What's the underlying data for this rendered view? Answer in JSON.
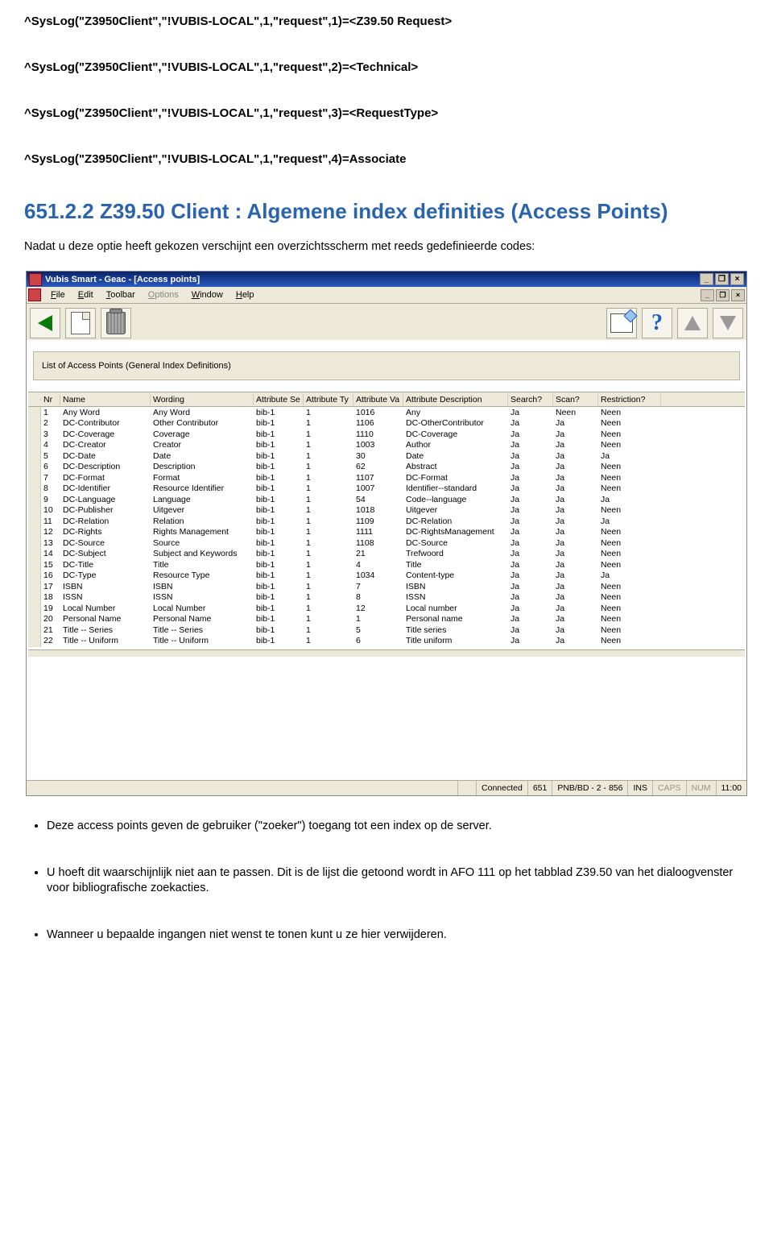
{
  "code_lines": [
    "^SysLog(\"Z3950Client\",\"!VUBIS-LOCAL\",1,\"request\",1)=<Z39.50 Request>",
    "^SysLog(\"Z3950Client\",\"!VUBIS-LOCAL\",1,\"request\",2)=<Technical>",
    "^SysLog(\"Z3950Client\",\"!VUBIS-LOCAL\",1,\"request\",3)=<RequestType>",
    "^SysLog(\"Z3950Client\",\"!VUBIS-LOCAL\",1,\"request\",4)=Associate"
  ],
  "heading": "651.2.2 Z39.50 Client : Algemene index definities (Access Points)",
  "intro": "Nadat u deze optie heeft gekozen verschijnt een overzichtsscherm met reeds gedefinieerde codes:",
  "app": {
    "title": "Vubis Smart - Geac - [Access points]",
    "menu": {
      "file": "File",
      "edit": "Edit",
      "toolbar": "Toolbar",
      "options": "Options",
      "window": "Window",
      "help": "Help"
    },
    "panel": "List of Access Points (General Index Definitions)",
    "columns": {
      "nr": "Nr",
      "name": "Name",
      "wording": "Wording",
      "attrset": "Attribute Se",
      "attrtype": "Attribute Ty",
      "attrval": "Attribute Va",
      "attrdesc": "Attribute Description",
      "search": "Search?",
      "scan": "Scan?",
      "restriction": "Restriction?"
    },
    "rows": [
      {
        "nr": "1",
        "name": "Any Word",
        "wording": "Any Word",
        "set": "bib-1",
        "type": "1",
        "val": "1016",
        "desc": "Any",
        "search": "Ja",
        "scan": "Neen",
        "restr": "Neen"
      },
      {
        "nr": "2",
        "name": "DC-Contributor",
        "wording": "Other Contributor",
        "set": "bib-1",
        "type": "1",
        "val": "1106",
        "desc": "DC-OtherContributor",
        "search": "Ja",
        "scan": "Ja",
        "restr": "Neen"
      },
      {
        "nr": "3",
        "name": "DC-Coverage",
        "wording": "Coverage",
        "set": "bib-1",
        "type": "1",
        "val": "1110",
        "desc": "DC-Coverage",
        "search": "Ja",
        "scan": "Ja",
        "restr": "Neen"
      },
      {
        "nr": "4",
        "name": "DC-Creator",
        "wording": "Creator",
        "set": "bib-1",
        "type": "1",
        "val": "1003",
        "desc": "Author",
        "search": "Ja",
        "scan": "Ja",
        "restr": "Neen"
      },
      {
        "nr": "5",
        "name": "DC-Date",
        "wording": "Date",
        "set": "bib-1",
        "type": "1",
        "val": "30",
        "desc": "Date",
        "search": "Ja",
        "scan": "Ja",
        "restr": "Ja"
      },
      {
        "nr": "6",
        "name": "DC-Description",
        "wording": "Description",
        "set": "bib-1",
        "type": "1",
        "val": "62",
        "desc": "Abstract",
        "search": "Ja",
        "scan": "Ja",
        "restr": "Neen"
      },
      {
        "nr": "7",
        "name": "DC-Format",
        "wording": "Format",
        "set": "bib-1",
        "type": "1",
        "val": "1107",
        "desc": "DC-Format",
        "search": "Ja",
        "scan": "Ja",
        "restr": "Neen"
      },
      {
        "nr": "8",
        "name": "DC-Identifier",
        "wording": "Resource Identifier",
        "set": "bib-1",
        "type": "1",
        "val": "1007",
        "desc": "Identifier--standard",
        "search": "Ja",
        "scan": "Ja",
        "restr": "Neen"
      },
      {
        "nr": "9",
        "name": "DC-Language",
        "wording": "Language",
        "set": "bib-1",
        "type": "1",
        "val": "54",
        "desc": "Code--language",
        "search": "Ja",
        "scan": "Ja",
        "restr": "Ja"
      },
      {
        "nr": "10",
        "name": "DC-Publisher",
        "wording": "Uitgever",
        "set": "bib-1",
        "type": "1",
        "val": "1018",
        "desc": "Uitgever",
        "search": "Ja",
        "scan": "Ja",
        "restr": "Neen"
      },
      {
        "nr": "11",
        "name": "DC-Relation",
        "wording": "Relation",
        "set": "bib-1",
        "type": "1",
        "val": "1109",
        "desc": "DC-Relation",
        "search": "Ja",
        "scan": "Ja",
        "restr": "Ja"
      },
      {
        "nr": "12",
        "name": "DC-Rights",
        "wording": "Rights Management",
        "set": "bib-1",
        "type": "1",
        "val": "1111",
        "desc": "DC-RightsManagement",
        "search": "Ja",
        "scan": "Ja",
        "restr": "Neen"
      },
      {
        "nr": "13",
        "name": "DC-Source",
        "wording": "Source",
        "set": "bib-1",
        "type": "1",
        "val": "1108",
        "desc": "DC-Source",
        "search": "Ja",
        "scan": "Ja",
        "restr": "Neen"
      },
      {
        "nr": "14",
        "name": "DC-Subject",
        "wording": "Subject and Keywords",
        "set": "bib-1",
        "type": "1",
        "val": "21",
        "desc": "Trefwoord",
        "search": "Ja",
        "scan": "Ja",
        "restr": "Neen"
      },
      {
        "nr": "15",
        "name": "DC-Title",
        "wording": "Title",
        "set": "bib-1",
        "type": "1",
        "val": "4",
        "desc": "Title",
        "search": "Ja",
        "scan": "Ja",
        "restr": "Neen"
      },
      {
        "nr": "16",
        "name": "DC-Type",
        "wording": "Resource Type",
        "set": "bib-1",
        "type": "1",
        "val": "1034",
        "desc": "Content-type",
        "search": "Ja",
        "scan": "Ja",
        "restr": "Ja"
      },
      {
        "nr": "17",
        "name": "ISBN",
        "wording": "ISBN",
        "set": "bib-1",
        "type": "1",
        "val": "7",
        "desc": "ISBN",
        "search": "Ja",
        "scan": "Ja",
        "restr": "Neen"
      },
      {
        "nr": "18",
        "name": "ISSN",
        "wording": "ISSN",
        "set": "bib-1",
        "type": "1",
        "val": "8",
        "desc": "ISSN",
        "search": "Ja",
        "scan": "Ja",
        "restr": "Neen"
      },
      {
        "nr": "19",
        "name": "Local Number",
        "wording": "Local Number",
        "set": "bib-1",
        "type": "1",
        "val": "12",
        "desc": "Local number",
        "search": "Ja",
        "scan": "Ja",
        "restr": "Neen"
      },
      {
        "nr": "20",
        "name": "Personal Name",
        "wording": "Personal Name",
        "set": "bib-1",
        "type": "1",
        "val": "1",
        "desc": "Personal name",
        "search": "Ja",
        "scan": "Ja",
        "restr": "Neen"
      },
      {
        "nr": "21",
        "name": "Title -- Series",
        "wording": "Title -- Series",
        "set": "bib-1",
        "type": "1",
        "val": "5",
        "desc": "Title series",
        "search": "Ja",
        "scan": "Ja",
        "restr": "Neen"
      },
      {
        "nr": "22",
        "name": "Title -- Uniform",
        "wording": "Title -- Uniform",
        "set": "bib-1",
        "type": "1",
        "val": "6",
        "desc": "Title uniform",
        "search": "Ja",
        "scan": "Ja",
        "restr": "Neen"
      }
    ],
    "status": {
      "connected": "Connected",
      "afo": "651",
      "session": "PNB/BD - 2 - 856",
      "ins": "INS",
      "caps": "CAPS",
      "num": "NUM",
      "time": "11:00"
    }
  },
  "bullets": [
    "Deze access points geven de gebruiker (\"zoeker\") toegang tot een index op de server.",
    "U hoeft dit waarschijnlijk niet aan te passen. Dit is de lijst die getoond wordt in AFO 111 op het tabblad Z39.50 van het dialoogvenster voor bibliografische zoekacties.",
    "Wanneer u bepaalde ingangen niet wenst te tonen kunt u ze hier verwijderen."
  ]
}
